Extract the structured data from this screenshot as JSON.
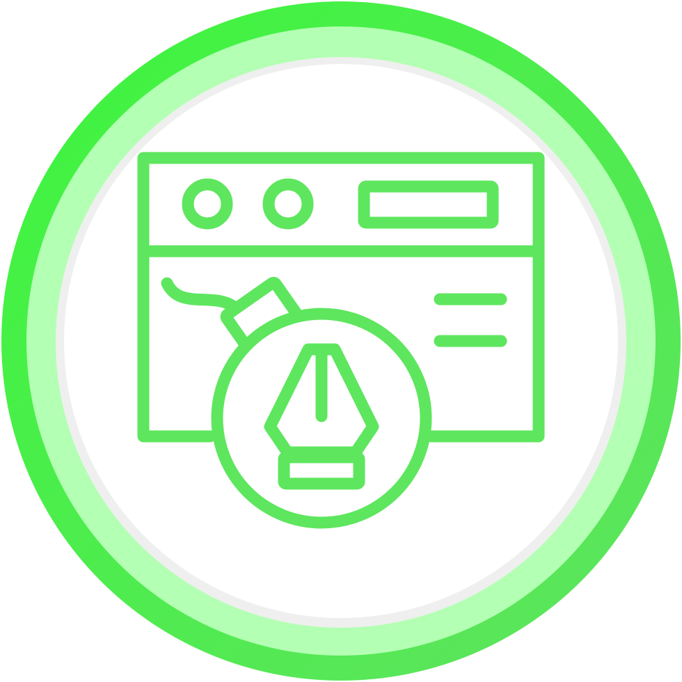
{
  "icon": {
    "name": "web-design-bomb-icon",
    "parts": [
      "outer-ring",
      "browser-window-icon",
      "window-dot-icon",
      "address-bar",
      "text-lines",
      "bomb-icon",
      "bomb-fuse",
      "pen-nib-icon"
    ]
  },
  "colors": {
    "ring_outer": "#3df53d",
    "ring_outer_edge": "#5fe35f",
    "ring_middle": "#b3ffb3",
    "ring_inner_shadow": "#efefef",
    "background": "#ffffff",
    "stroke": "#5ee65e"
  }
}
